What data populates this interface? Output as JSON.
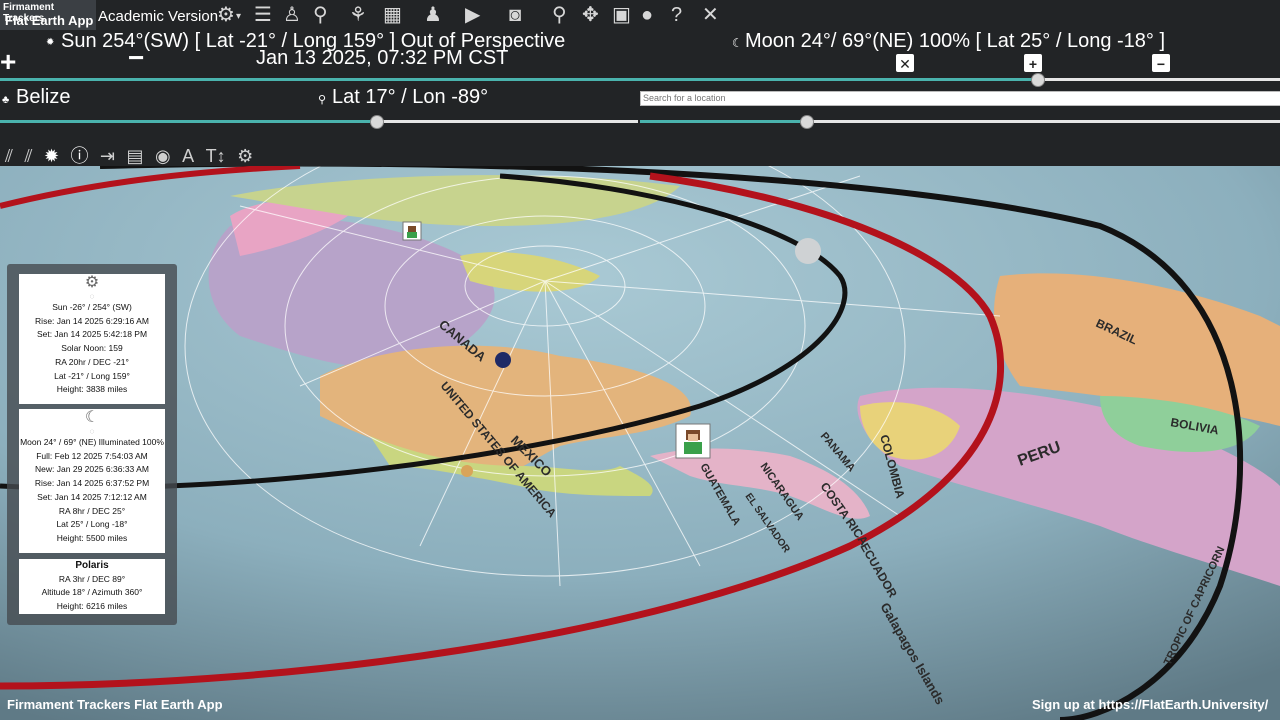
{
  "app": {
    "logo_line1": "Firmament Trackers",
    "logo_line2": "Flat Earth App",
    "version": "Academic Version"
  },
  "toolbar_icons": [
    "gear-icon",
    "menu-icon",
    "observer-icon",
    "walk-icon",
    "run-icon",
    "map-icon",
    "person-add-icon",
    "video-icon",
    "camera-icon",
    "search-icon",
    "move-icon",
    "calendar-icon",
    "circle-icon",
    "help-icon",
    "close-icon"
  ],
  "header": {
    "sun": "Sun 254°(SW) [ Lat -21° / Long 159° ] Out of Perspective",
    "datetime": "Jan 13 2025, 07:32 PM CST",
    "moon": "Moon 24°/ 69°(NE) 100% [ Lat 25° / Long -18° ]",
    "time_slider": 0.81
  },
  "location": {
    "name": "Belize",
    "latlon": "Lat 17° / Lon -89°",
    "search_placeholder": "Search for a location",
    "slider_left": 0.59,
    "slider_right": 0.26
  },
  "sun_card": {
    "lines": [
      "Sun -26° / 254° (SW)",
      "Rise: Jan 14 2025 6:29:16 AM",
      "Set: Jan 14 2025 5:42:18 PM",
      "Solar Noon: 159",
      "RA 20hr / DEC -21°",
      "Lat -21° / Long 159°",
      "Height: 3838 miles"
    ]
  },
  "moon_card": {
    "lines": [
      "Moon 24° / 69° (NE) Illuminated 100%",
      "Full: Feb 12 2025 7:54:03 AM",
      "New: Jan 29 2025 6:36:33 AM",
      "Rise: Jan 14 2025 6:37:52 PM",
      "Set: Jan 14 2025 7:12:12 AM",
      "RA 8hr / DEC 25°",
      "Lat 25° / Long -18°",
      "Height: 5500 miles"
    ]
  },
  "polaris_card": {
    "title": "Polaris",
    "lines": [
      "RA 3hr / DEC 89°",
      "Altitude 18° / Azimuth 360°",
      "Height: 6216 miles"
    ]
  },
  "map_labels": {
    "canada": "CANADA",
    "usa": "UNITED STATES OF AMERICA",
    "mexico": "MEXICO",
    "guatemala": "GUATEMALA",
    "el_salvador": "EL SALVADOR",
    "nicaragua": "NICARAGUA",
    "costa_rica": "COSTA RICA",
    "panama": "PANAMA",
    "colombia": "COLOMBIA",
    "ecuador": "ECUADOR",
    "peru": "PERU",
    "brazil": "BRAZIL",
    "bolivia": "BOLIVIA",
    "galapagos": "Galapagos Islands",
    "tropic": "TROPIC OF CAPRICORN"
  },
  "footer": {
    "left": "Firmament Trackers Flat Earth App",
    "right": "Sign up at https://FlatEarth.University/"
  },
  "colors": {
    "accent": "#4ab3ad",
    "ocean": "#8fb5c4",
    "tropic_red": "#b3121c"
  }
}
